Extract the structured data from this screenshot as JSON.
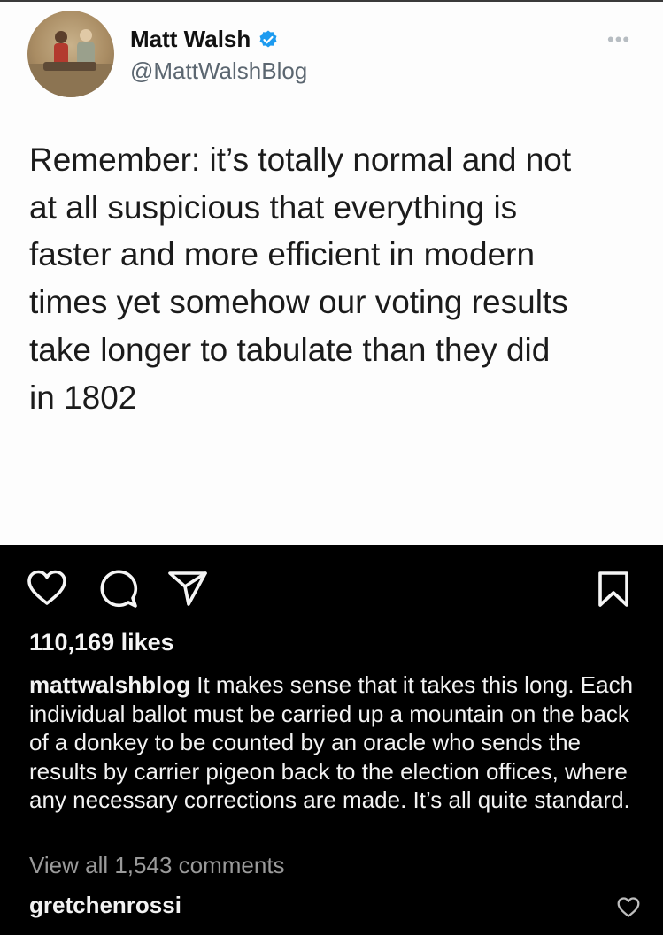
{
  "tweet": {
    "display_name": "Matt Walsh",
    "handle": "@MattWalshBlog",
    "more_label": "•••",
    "text": "Remember: it’s totally normal and not\nat all suspicious that everything is\nfaster and more efficient in modern\ntimes yet somehow our voting results\ntake longer to tabulate than they did\nin 1802"
  },
  "post": {
    "likes": "110,169 likes",
    "caption_user": "mattwalshblog",
    "caption_text": " It makes sense that it takes this long. Each individual ballot must be carried up a mountain on the back of a donkey to be counted by an oracle who sends the results by carrier pigeon back to the election offices, where any necessary corrections are made. It’s all quite standard.",
    "view_comments": "View all 1,543 comments",
    "comment_user": "gretchenrossi",
    "comment_emojis": "😂😂😂😂"
  },
  "icons": {
    "like": "heart-icon",
    "comment": "comment-bubble-icon",
    "share": "send-icon",
    "save": "bookmark-icon",
    "verified": "verified-badge-icon"
  },
  "colors": {
    "verified_blue": "#1d9bf0",
    "background": "#000000",
    "tweet_bg": "#fdfdfd"
  }
}
